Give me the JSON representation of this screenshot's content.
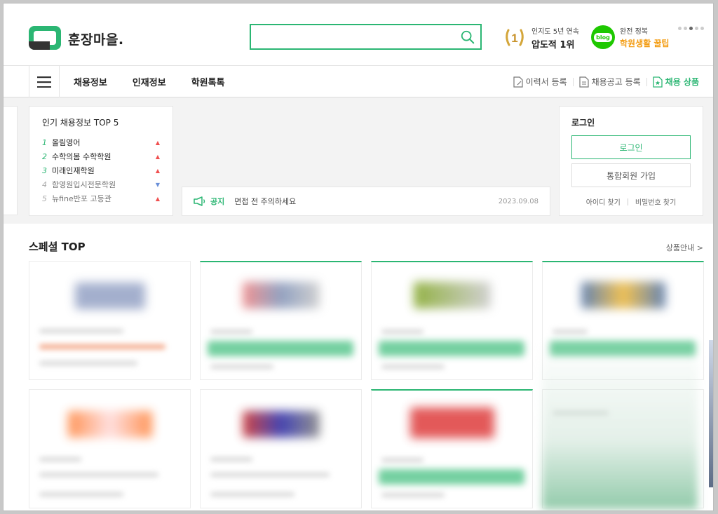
{
  "header": {
    "logo_text": "훈장마을.",
    "search": {
      "placeholder": ""
    },
    "badge_rank": {
      "line1": "인지도 5년 연속",
      "line2": "압도적 1위",
      "medal_number": "1"
    },
    "badge_blog": {
      "icon_text": "blog",
      "line1": "완전 정복",
      "line2": "학원생활 꿀팁"
    }
  },
  "nav": {
    "items": [
      "채용정보",
      "인재정보",
      "학원톡톡"
    ],
    "right": [
      "이력서 등록",
      "채용공고 등록",
      "채용 상품"
    ]
  },
  "popular": {
    "title": "인기 채용정보 TOP 5",
    "items": [
      {
        "rank": "1",
        "name": "올림영어",
        "trend": "▲"
      },
      {
        "rank": "2",
        "name": "수학의봄 수학학원",
        "trend": "▲"
      },
      {
        "rank": "3",
        "name": "미래인재학원",
        "trend": "▲"
      },
      {
        "rank": "4",
        "name": "함영원입시전문학원",
        "trend": "▼"
      },
      {
        "rank": "5",
        "name": "뉴fine반포 고등관",
        "trend": "▲"
      }
    ]
  },
  "notice": {
    "label": "공지",
    "message": "면접 전 주의하세요",
    "date": "2023.09.08"
  },
  "login": {
    "title": "로그인",
    "login_button": "로그인",
    "join_button": "통합회원 가입",
    "find_id": "아이디 찾기",
    "find_pw": "비밀번호 찾기"
  },
  "special": {
    "title": "스페셜 TOP",
    "more": "상품안내 >"
  },
  "colors": {
    "accent": "#2bb673",
    "rise": "#f05050",
    "fall": "#6a8fd8",
    "blog": "#1ec800",
    "tip": "#f39c12"
  }
}
